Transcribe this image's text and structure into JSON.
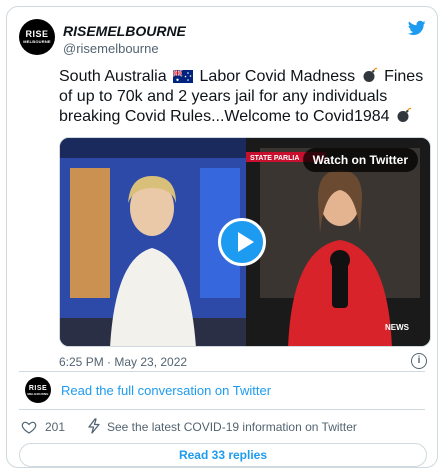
{
  "author": {
    "name": "RISEMELBOURNE",
    "handle": "@risemelbourne",
    "avatar_text_top": "RISE",
    "avatar_text_bottom": "MELBOURNE"
  },
  "tweet": {
    "text_part1": "South Australia",
    "text_part2": "Labor Covid Madness",
    "text_part3": "Fines of up to 70k and 2 years jail for any individuals breaking Covid Rules...Welcome to Covid1984",
    "emoji_flag": "australia-flag",
    "emoji_bomb": "bomb"
  },
  "video": {
    "watch_label": "Watch on Twitter",
    "state_banner": "STATE PARLIA",
    "news_badge": "NEWS"
  },
  "meta": {
    "timestamp": "6:25 PM · May 23, 2022",
    "info_glyph": "i"
  },
  "conversation": {
    "link_text": "Read the full conversation on Twitter"
  },
  "actions": {
    "likes": "201",
    "covid_info": "See the latest COVID-19 information on Twitter",
    "replies_button": "Read 33 replies"
  },
  "colors": {
    "accent": "#1d9bf0",
    "muted": "#536471",
    "border": "#cfd9de"
  }
}
